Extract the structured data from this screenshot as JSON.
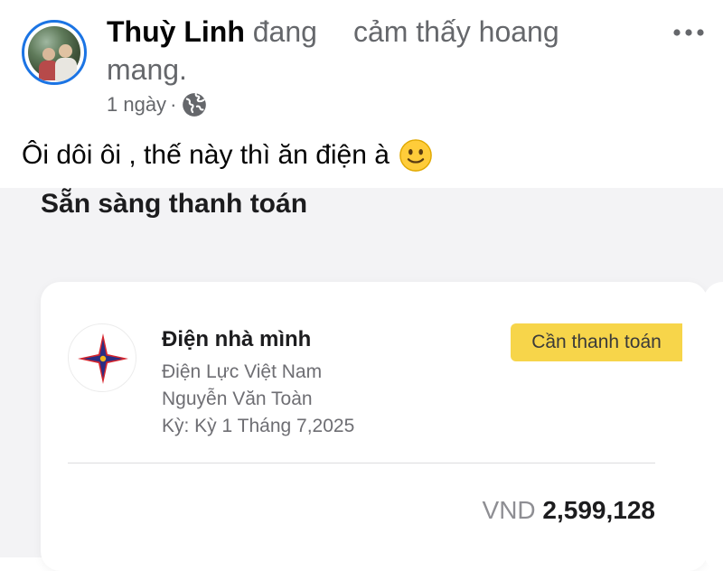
{
  "post": {
    "author": "Thuỳ Linh",
    "feeling_prefix": "đang",
    "feeling_text": "cảm thấy hoang",
    "feeling_wrap": "mang.",
    "time": "1 ngày",
    "separator": "·",
    "privacy_icon": "globe-icon",
    "more_icon": "ellipsis-icon",
    "caption": "Ôi dôi ôi , thế này thì ăn điện à",
    "caption_emoji": "slightly-smiling-face-icon"
  },
  "bill_screen": {
    "section_title": "Sẵn sàng thanh toán",
    "card": {
      "logo_icon": "evn-star-logo-icon",
      "name": "Điện nhà mình",
      "provider": "Điện Lực Việt Nam",
      "customer": "Nguyễn Văn Toàn",
      "period": "Kỳ: Kỳ 1 Tháng 7,2025",
      "status": "Cần thanh toán",
      "currency": "VND",
      "amount": "2,599,128"
    }
  },
  "colors": {
    "avatar_ring": "#1b74e4",
    "status_badge": "#f7d54a",
    "muted_text": "#65676b"
  }
}
